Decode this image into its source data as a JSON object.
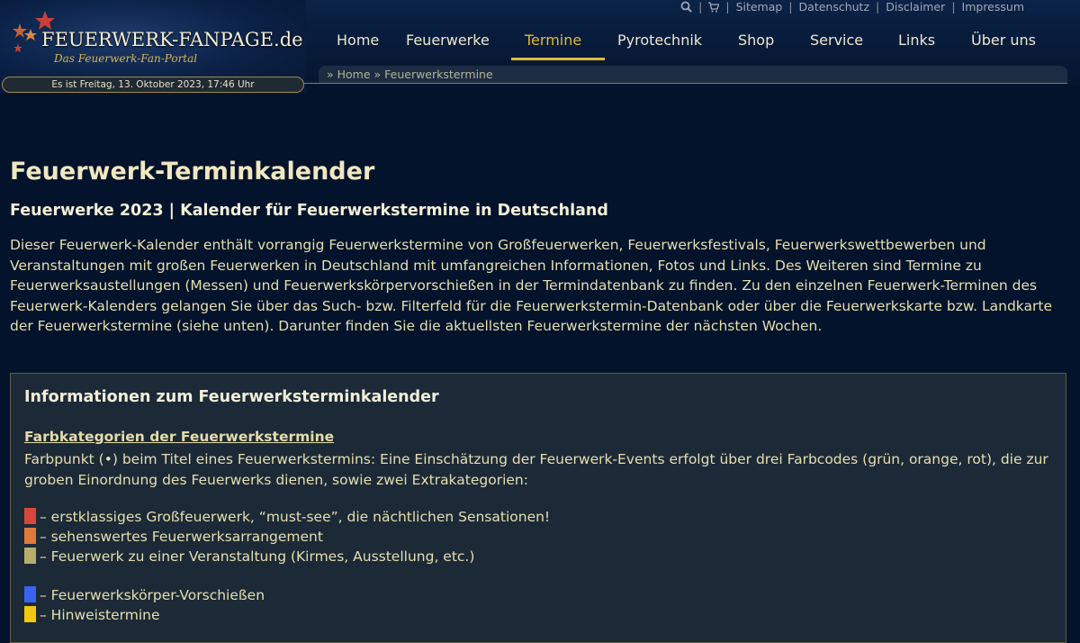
{
  "header": {
    "logo_title": "FEUERWERK-FANPAGE.de",
    "logo_subtitle": "Das Feuerwerk-Fan-Portal",
    "date_text": "Es ist Freitag, 13. Oktober 2023, 17:46 Uhr",
    "toplinks": {
      "sitemap": "Sitemap",
      "datenschutz": "Datenschutz",
      "disclaimer": "Disclaimer",
      "impressum": "Impressum"
    },
    "nav": [
      {
        "label": "Home"
      },
      {
        "label": "Feuerwerke"
      },
      {
        "label": "Termine",
        "active": true
      },
      {
        "label": "Pyrotechnik"
      },
      {
        "label": "Shop"
      },
      {
        "label": "Service"
      },
      {
        "label": "Links"
      },
      {
        "label": "Über uns"
      }
    ],
    "breadcrumb": "» Home » Feuerwerkstermine"
  },
  "main": {
    "title": "Feuerwerk-Terminkalender",
    "subtitle": "Feuerwerke 2023 | Kalender für Feuerwerkstermine in Deutschland",
    "intro": "Dieser Feuerwerk-Kalender enthält vorrangig Feuerwerkstermine von Großfeuerwerken, Feuerwerksfestivals, Feuerwerkswettbewerben und Veranstaltungen mit großen Feuerwerken in Deutschland mit umfangreichen Informationen, Fotos und Links. Des Weiteren sind Termine zu Feuerwerksaustellungen (Messen) und Feuerwerkskörpervorschießen in der Termindatenbank zu finden. Zu den einzelnen Feuerwerk-Terminen des Feuerwerk-Kalenders gelangen Sie über das Such- bzw. Filterfeld für die Feuerwerkstermin-Datenbank oder über die Feuerwerkskarte bzw. Landkarte der Feuerwerkstermine (siehe unten). Darunter finden Sie die aktuellsten Feuerwerkstermine der nächsten Wochen."
  },
  "info_box": {
    "title": "Informationen zum Feuerwerksterminkalender",
    "category_title": "Farbkategorien der Feuerwerkstermine",
    "category_desc": "Farbpunkt (•) beim Titel eines Feuerwerkstermins: Eine Einschätzung der Feuerwerk-Events erfolgt über drei Farbcodes (grün, orange, rot), die zur groben Einordnung des Feuerwerks dienen, sowie zwei Extrakategorien:",
    "legend": [
      {
        "color": "#d9473a",
        "label": "– erstklassiges Großfeuerwerk, “must-see”, die nächtlichen Sensationen!"
      },
      {
        "color": "#de7a3c",
        "label": "– sehenswertes Feuerwerksarrangement"
      },
      {
        "color": "#b6ae6c",
        "label": "– Feuerwerk zu einer Veranstaltung (Kirmes, Ausstellung, etc.)"
      },
      {
        "color": "#3a63f0",
        "label": "– Feuerwerkskörper-Vorschießen"
      },
      {
        "color": "#f3c60f",
        "label": "– Hinweistermine"
      }
    ]
  },
  "colors": {
    "accent": "#e0b93c",
    "background": "#02132b"
  }
}
